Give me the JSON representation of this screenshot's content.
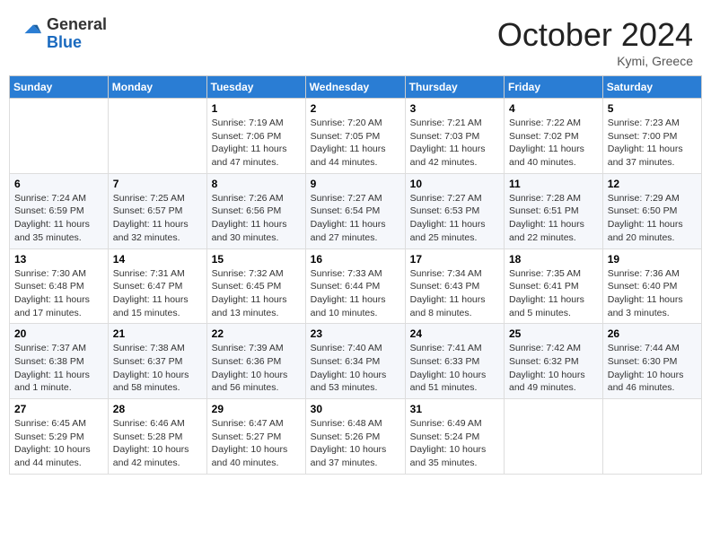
{
  "header": {
    "logo_general": "General",
    "logo_blue": "Blue",
    "month_title": "October 2024",
    "location": "Kymi, Greece"
  },
  "days_of_week": [
    "Sunday",
    "Monday",
    "Tuesday",
    "Wednesday",
    "Thursday",
    "Friday",
    "Saturday"
  ],
  "weeks": [
    [
      {
        "day": "",
        "info": ""
      },
      {
        "day": "",
        "info": ""
      },
      {
        "day": "1",
        "info": "Sunrise: 7:19 AM\nSunset: 7:06 PM\nDaylight: 11 hours and 47 minutes."
      },
      {
        "day": "2",
        "info": "Sunrise: 7:20 AM\nSunset: 7:05 PM\nDaylight: 11 hours and 44 minutes."
      },
      {
        "day": "3",
        "info": "Sunrise: 7:21 AM\nSunset: 7:03 PM\nDaylight: 11 hours and 42 minutes."
      },
      {
        "day": "4",
        "info": "Sunrise: 7:22 AM\nSunset: 7:02 PM\nDaylight: 11 hours and 40 minutes."
      },
      {
        "day": "5",
        "info": "Sunrise: 7:23 AM\nSunset: 7:00 PM\nDaylight: 11 hours and 37 minutes."
      }
    ],
    [
      {
        "day": "6",
        "info": "Sunrise: 7:24 AM\nSunset: 6:59 PM\nDaylight: 11 hours and 35 minutes."
      },
      {
        "day": "7",
        "info": "Sunrise: 7:25 AM\nSunset: 6:57 PM\nDaylight: 11 hours and 32 minutes."
      },
      {
        "day": "8",
        "info": "Sunrise: 7:26 AM\nSunset: 6:56 PM\nDaylight: 11 hours and 30 minutes."
      },
      {
        "day": "9",
        "info": "Sunrise: 7:27 AM\nSunset: 6:54 PM\nDaylight: 11 hours and 27 minutes."
      },
      {
        "day": "10",
        "info": "Sunrise: 7:27 AM\nSunset: 6:53 PM\nDaylight: 11 hours and 25 minutes."
      },
      {
        "day": "11",
        "info": "Sunrise: 7:28 AM\nSunset: 6:51 PM\nDaylight: 11 hours and 22 minutes."
      },
      {
        "day": "12",
        "info": "Sunrise: 7:29 AM\nSunset: 6:50 PM\nDaylight: 11 hours and 20 minutes."
      }
    ],
    [
      {
        "day": "13",
        "info": "Sunrise: 7:30 AM\nSunset: 6:48 PM\nDaylight: 11 hours and 17 minutes."
      },
      {
        "day": "14",
        "info": "Sunrise: 7:31 AM\nSunset: 6:47 PM\nDaylight: 11 hours and 15 minutes."
      },
      {
        "day": "15",
        "info": "Sunrise: 7:32 AM\nSunset: 6:45 PM\nDaylight: 11 hours and 13 minutes."
      },
      {
        "day": "16",
        "info": "Sunrise: 7:33 AM\nSunset: 6:44 PM\nDaylight: 11 hours and 10 minutes."
      },
      {
        "day": "17",
        "info": "Sunrise: 7:34 AM\nSunset: 6:43 PM\nDaylight: 11 hours and 8 minutes."
      },
      {
        "day": "18",
        "info": "Sunrise: 7:35 AM\nSunset: 6:41 PM\nDaylight: 11 hours and 5 minutes."
      },
      {
        "day": "19",
        "info": "Sunrise: 7:36 AM\nSunset: 6:40 PM\nDaylight: 11 hours and 3 minutes."
      }
    ],
    [
      {
        "day": "20",
        "info": "Sunrise: 7:37 AM\nSunset: 6:38 PM\nDaylight: 11 hours and 1 minute."
      },
      {
        "day": "21",
        "info": "Sunrise: 7:38 AM\nSunset: 6:37 PM\nDaylight: 10 hours and 58 minutes."
      },
      {
        "day": "22",
        "info": "Sunrise: 7:39 AM\nSunset: 6:36 PM\nDaylight: 10 hours and 56 minutes."
      },
      {
        "day": "23",
        "info": "Sunrise: 7:40 AM\nSunset: 6:34 PM\nDaylight: 10 hours and 53 minutes."
      },
      {
        "day": "24",
        "info": "Sunrise: 7:41 AM\nSunset: 6:33 PM\nDaylight: 10 hours and 51 minutes."
      },
      {
        "day": "25",
        "info": "Sunrise: 7:42 AM\nSunset: 6:32 PM\nDaylight: 10 hours and 49 minutes."
      },
      {
        "day": "26",
        "info": "Sunrise: 7:44 AM\nSunset: 6:30 PM\nDaylight: 10 hours and 46 minutes."
      }
    ],
    [
      {
        "day": "27",
        "info": "Sunrise: 6:45 AM\nSunset: 5:29 PM\nDaylight: 10 hours and 44 minutes."
      },
      {
        "day": "28",
        "info": "Sunrise: 6:46 AM\nSunset: 5:28 PM\nDaylight: 10 hours and 42 minutes."
      },
      {
        "day": "29",
        "info": "Sunrise: 6:47 AM\nSunset: 5:27 PM\nDaylight: 10 hours and 40 minutes."
      },
      {
        "day": "30",
        "info": "Sunrise: 6:48 AM\nSunset: 5:26 PM\nDaylight: 10 hours and 37 minutes."
      },
      {
        "day": "31",
        "info": "Sunrise: 6:49 AM\nSunset: 5:24 PM\nDaylight: 10 hours and 35 minutes."
      },
      {
        "day": "",
        "info": ""
      },
      {
        "day": "",
        "info": ""
      }
    ]
  ]
}
